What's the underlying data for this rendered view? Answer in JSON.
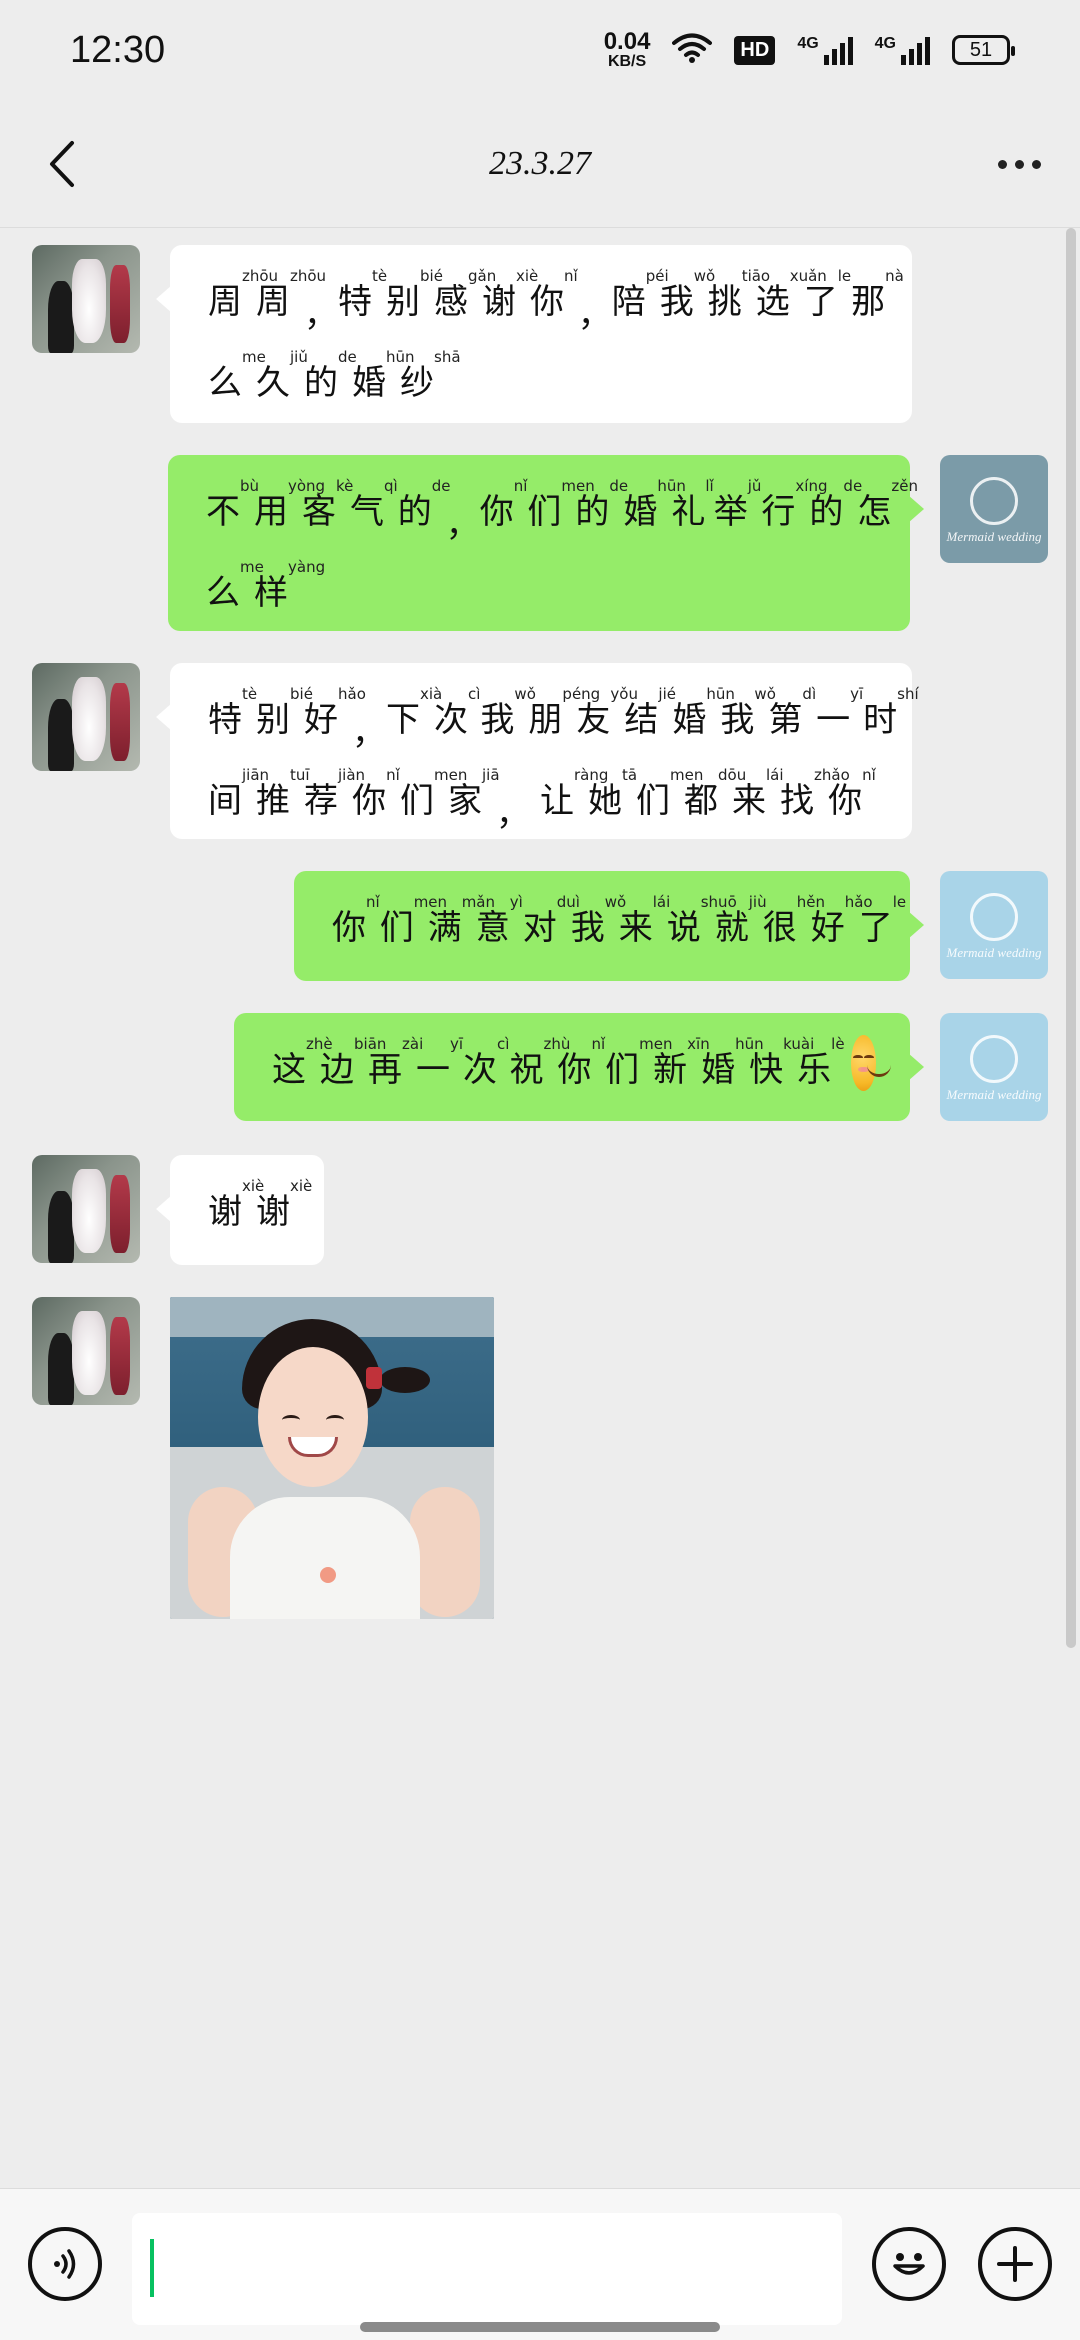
{
  "status_bar": {
    "time": "12:30",
    "net_speed_value": "0.04",
    "net_speed_unit": "KB/S",
    "hd_label": "HD",
    "signal1_label": "4G",
    "signal2_label": "4G",
    "battery": "51",
    "icons": [
      "wifi-icon",
      "hd-icon",
      "signal-icon",
      "signal-icon",
      "battery-icon"
    ]
  },
  "header": {
    "title": "23.3.27",
    "back_icon": "chevron-left-icon",
    "more_icon": "more-dots-icon"
  },
  "messages": [
    {
      "side": "left",
      "type": "text",
      "text": "周周，特别感谢你，陪我挑选了那么久的婚纱",
      "lines": [
        [
          [
            "周",
            "zhōu"
          ],
          [
            "周",
            "zhōu"
          ],
          [
            "，",
            ""
          ],
          [
            "特",
            "tè"
          ],
          [
            "别",
            "bié"
          ],
          [
            "感",
            "gǎn"
          ],
          [
            "谢",
            "xiè"
          ],
          [
            "你",
            "nǐ"
          ],
          [
            "，",
            ""
          ],
          [
            "陪",
            "péi"
          ],
          [
            "我",
            "wǒ"
          ],
          [
            "挑",
            "tiāo"
          ],
          [
            "选",
            "xuǎn"
          ],
          [
            "了",
            "le"
          ],
          [
            "那",
            "nà"
          ]
        ],
        [
          [
            "么",
            "me"
          ],
          [
            "久",
            "jiǔ"
          ],
          [
            "的",
            "de"
          ],
          [
            "婚",
            "hūn"
          ],
          [
            "纱",
            "shā"
          ]
        ]
      ]
    },
    {
      "side": "right",
      "type": "text",
      "text": "不用客气的，你们的婚礼举行的怎么样",
      "lines": [
        [
          [
            "不",
            "bù"
          ],
          [
            "用",
            "yòng"
          ],
          [
            "客",
            "kè"
          ],
          [
            "气",
            "qì"
          ],
          [
            "的",
            "de"
          ],
          [
            "，",
            ""
          ],
          [
            "你",
            "nǐ"
          ],
          [
            "们",
            "men"
          ],
          [
            "的",
            "de"
          ],
          [
            "婚",
            "hūn"
          ],
          [
            "礼",
            "lǐ"
          ],
          [
            "举",
            "jǔ"
          ],
          [
            "行",
            "xíng"
          ],
          [
            "的",
            "de"
          ],
          [
            "怎",
            "zěn"
          ]
        ],
        [
          [
            "么",
            "me"
          ],
          [
            "样",
            "yàng"
          ]
        ]
      ]
    },
    {
      "side": "left",
      "type": "text",
      "text": "特别好，下次我朋友结婚我第一时间推荐你们家，让她们都来找你",
      "lines": [
        [
          [
            "特",
            "tè"
          ],
          [
            "别",
            "bié"
          ],
          [
            "好",
            "hǎo"
          ],
          [
            "，",
            ""
          ],
          [
            "下",
            "xià"
          ],
          [
            "次",
            "cì"
          ],
          [
            "我",
            "wǒ"
          ],
          [
            "朋",
            "péng"
          ],
          [
            "友",
            "yǒu"
          ],
          [
            "结",
            "jié"
          ],
          [
            "婚",
            "hūn"
          ],
          [
            "我",
            "wǒ"
          ],
          [
            "第",
            "dì"
          ],
          [
            "一",
            "yī"
          ],
          [
            "时",
            "shí"
          ]
        ],
        [
          [
            "间",
            "jiān"
          ],
          [
            "推",
            "tuī"
          ],
          [
            "荐",
            "jiàn"
          ],
          [
            "你",
            "nǐ"
          ],
          [
            "们",
            "men"
          ],
          [
            "家",
            "jiā"
          ],
          [
            "，",
            ""
          ],
          [
            "让",
            "ràng"
          ],
          [
            "她",
            "tā"
          ],
          [
            "们",
            "men"
          ],
          [
            "都",
            "dōu"
          ],
          [
            "来",
            "lái"
          ],
          [
            "找",
            "zhǎo"
          ],
          [
            "你",
            "nǐ"
          ]
        ]
      ]
    },
    {
      "side": "right",
      "type": "text",
      "text": "你们满意对我来说就很好了",
      "lines": [
        [
          [
            "你",
            "nǐ"
          ],
          [
            "们",
            "men"
          ],
          [
            "满",
            "mǎn"
          ],
          [
            "意",
            "yì"
          ],
          [
            "对",
            "duì"
          ],
          [
            "我",
            "wǒ"
          ],
          [
            "来",
            "lái"
          ],
          [
            "说",
            "shuō"
          ],
          [
            "就",
            "jiù"
          ],
          [
            "很",
            "hěn"
          ],
          [
            "好",
            "hǎo"
          ],
          [
            "了",
            "le"
          ]
        ]
      ]
    },
    {
      "side": "right",
      "type": "text",
      "text": "这边再一次祝你们新婚快乐",
      "emoji": "smiling-face-emoji",
      "lines": [
        [
          [
            "这",
            "zhè"
          ],
          [
            "边",
            "biān"
          ],
          [
            "再",
            "zài"
          ],
          [
            "一",
            "yī"
          ],
          [
            "次",
            "cì"
          ],
          [
            "祝",
            "zhù"
          ],
          [
            "你",
            "nǐ"
          ],
          [
            "们",
            "men"
          ],
          [
            "新",
            "xīn"
          ],
          [
            "婚",
            "hūn"
          ],
          [
            "快",
            "kuài"
          ],
          [
            "乐",
            "lè"
          ]
        ]
      ]
    },
    {
      "side": "left",
      "type": "text",
      "text": "谢谢",
      "lines": [
        [
          [
            "谢",
            "xiè"
          ],
          [
            "谢",
            "xiè"
          ]
        ]
      ]
    },
    {
      "side": "left",
      "type": "image",
      "image": "smiling-child-sticker"
    }
  ],
  "avatars": {
    "left": "wedding-dress-avatar",
    "right": "mermaid-wedding-logo-avatar"
  },
  "right_avatar_brand": "Mermaid wedding",
  "input_bar": {
    "voice_icon": "voice-icon",
    "input_value": "",
    "emoji_icon": "emoji-icon",
    "plus_icon": "plus-icon"
  },
  "colors": {
    "background": "#ededed",
    "bubble_sent": "#95ec69",
    "bubble_received": "#ffffff",
    "caret": "#07c160"
  }
}
